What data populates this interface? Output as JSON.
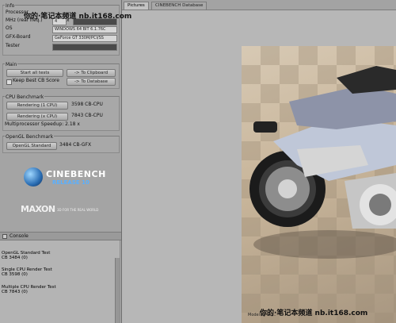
{
  "watermark_top": "你的·笔记本频道 nb.it168.com",
  "watermark_bottom": "你的·笔记本频道 nb.it168.com",
  "info": {
    "title": "Info",
    "processor_label": "Processor",
    "mhz_label": "MHz (real freq.)",
    "mhz_value": "4",
    "mhz_x": "x",
    "os_label": "OS",
    "os_value": "WINDOWS 64 BIT 6.1.76C",
    "gfx_label": "GFX-Board",
    "gfx_value": "GeForce GT 330M/PCI/SS",
    "tester_label": "Tester",
    "tester_value": ""
  },
  "main": {
    "title": "Main",
    "start_all": "Start all tests",
    "to_clipboard": "-> To Clipboard",
    "keep_best": "Keep Best CB Score",
    "to_database": "-> To Database"
  },
  "cpu": {
    "title": "CPU Benchmark",
    "render1": "Rendering (1 CPU)",
    "render1_score": "3598 CB-CPU",
    "renderx": "Rendering (x CPU)",
    "renderx_score": "7843 CB-CPU",
    "speedup": "Multiprocessor Speedup: 2.18 x"
  },
  "opengl": {
    "title": "OpenGL Benchmark",
    "standard": "OpenGL Standard",
    "score": "3484 CB-GFX"
  },
  "logo": {
    "cinebench": "CINEBENCH",
    "release": "RELEASE 10",
    "maxon": "MAXON",
    "tagline": "3D FOR THE REAL WORLD"
  },
  "console": {
    "title": "Console",
    "lines": [
      "OpenGL Standard Test",
      "CB 3484 (0)",
      "",
      "Single CPU Render Test",
      "CB 3598 (0)",
      "",
      "Multiple CPU Render Test",
      "CB 7843 (0)"
    ]
  },
  "tabs": {
    "pictures": "Pictures",
    "database": "CINEBENCH Database"
  },
  "render_caption": "Model by Co..."
}
